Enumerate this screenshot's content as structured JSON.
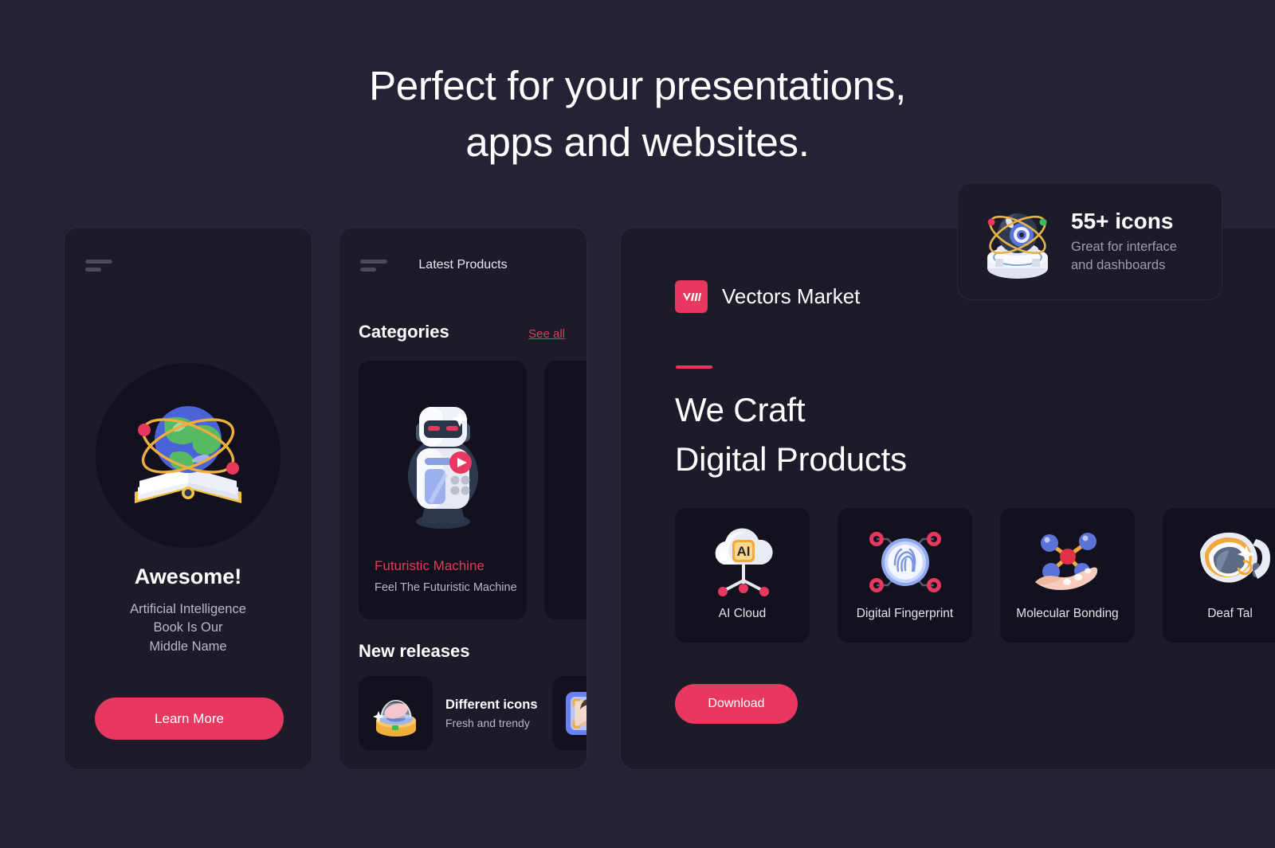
{
  "page": {
    "headline_line1": "Perfect for your presentations,",
    "headline_line2": "apps and websites.",
    "background_color": "#242336",
    "card_color": "#1c1b29",
    "tile_color": "#12111d",
    "accent_color": "#e8385f"
  },
  "card_app": {
    "menu_icon": "hamburger-icon",
    "illustration": "globe-on-open-book-icon",
    "title": "Awesome!",
    "subtitle_line1": "Artificial Intelligence",
    "subtitle_line2": "Book Is Our",
    "subtitle_line3": "Middle Name",
    "cta_label": "Learn More"
  },
  "card_products": {
    "menu_icon": "hamburger-icon",
    "app_title": "Latest Products",
    "categories_heading": "Categories",
    "see_all_label": "See all",
    "categories": [
      {
        "icon": "robot-icon",
        "name": "Futuristic Machine",
        "description": "Feel The Futuristic Machine"
      },
      {
        "icon": "partial-card-icon",
        "name": "",
        "description": ""
      }
    ],
    "new_releases_heading": "New releases",
    "releases": [
      {
        "icon": "hologram-projector-icon",
        "title": "Different icons",
        "subtitle": "Fresh and trendy"
      },
      {
        "icon": "face-recognition-icon",
        "title": "",
        "subtitle": ""
      }
    ]
  },
  "card_main": {
    "brand_logo_icon": "vectors-market-logo",
    "brand_name": "Vectors Market",
    "heading_line1": "We Craft",
    "heading_line2": "Digital Products",
    "tiles": [
      {
        "icon": "ai-cloud-icon",
        "label": "AI Cloud"
      },
      {
        "icon": "digital-fingerprint-icon",
        "label": "Digital Fingerprint"
      },
      {
        "icon": "molecular-bonding-icon",
        "label": "Molecular Bonding"
      },
      {
        "icon": "deaf-talking-watch-icon",
        "label": "Deaf Tal"
      }
    ],
    "download_label": "Download"
  },
  "badge": {
    "icon": "orbiting-eye-pedestal-icon",
    "title": "55+ icons",
    "subtitle_line1": "Great for interface",
    "subtitle_line2": "and dashboards"
  }
}
